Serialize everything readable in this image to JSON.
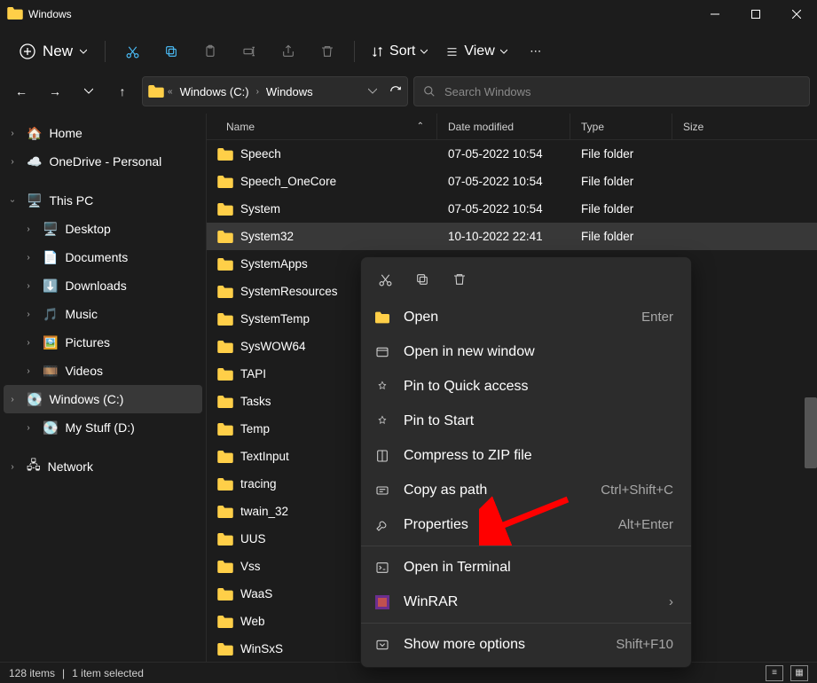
{
  "window": {
    "title": "Windows"
  },
  "toolbar": {
    "new": "New",
    "sort": "Sort",
    "view": "View"
  },
  "breadcrumb": {
    "drive": "Windows (C:)",
    "folder": "Windows"
  },
  "search": {
    "placeholder": "Search Windows"
  },
  "sidebar": {
    "home": "Home",
    "onedrive": "OneDrive - Personal",
    "thispc": "This PC",
    "desktop": "Desktop",
    "documents": "Documents",
    "downloads": "Downloads",
    "music": "Music",
    "pictures": "Pictures",
    "videos": "Videos",
    "cdrive": "Windows (C:)",
    "ddrive": "My Stuff (D:)",
    "network": "Network"
  },
  "columns": {
    "name": "Name",
    "modified": "Date modified",
    "type": "Type",
    "size": "Size"
  },
  "rows": [
    {
      "name": "Speech",
      "date": "07-05-2022 10:54",
      "type": "File folder"
    },
    {
      "name": "Speech_OneCore",
      "date": "07-05-2022 10:54",
      "type": "File folder"
    },
    {
      "name": "System",
      "date": "07-05-2022 10:54",
      "type": "File folder"
    },
    {
      "name": "System32",
      "date": "10-10-2022 22:41",
      "type": "File folder",
      "selected": true
    },
    {
      "name": "SystemApps",
      "date": "",
      "type": ""
    },
    {
      "name": "SystemResources",
      "date": "",
      "type": ""
    },
    {
      "name": "SystemTemp",
      "date": "",
      "type": ""
    },
    {
      "name": "SysWOW64",
      "date": "",
      "type": ""
    },
    {
      "name": "TAPI",
      "date": "",
      "type": ""
    },
    {
      "name": "Tasks",
      "date": "",
      "type": ""
    },
    {
      "name": "Temp",
      "date": "",
      "type": ""
    },
    {
      "name": "TextInput",
      "date": "",
      "type": ""
    },
    {
      "name": "tracing",
      "date": "",
      "type": ""
    },
    {
      "name": "twain_32",
      "date": "",
      "type": ""
    },
    {
      "name": "UUS",
      "date": "",
      "type": ""
    },
    {
      "name": "Vss",
      "date": "",
      "type": ""
    },
    {
      "name": "WaaS",
      "date": "",
      "type": ""
    },
    {
      "name": "Web",
      "date": "",
      "type": ""
    },
    {
      "name": "WinSxS",
      "date": "",
      "type": ""
    }
  ],
  "context_menu": [
    {
      "icon": "folder",
      "label": "Open",
      "accel": "Enter"
    },
    {
      "icon": "window",
      "label": "Open in new window",
      "accel": ""
    },
    {
      "icon": "pin",
      "label": "Pin to Quick access",
      "accel": ""
    },
    {
      "icon": "pin",
      "label": "Pin to Start",
      "accel": ""
    },
    {
      "icon": "zip",
      "label": "Compress to ZIP file",
      "accel": ""
    },
    {
      "icon": "path",
      "label": "Copy as path",
      "accel": "Ctrl+Shift+C"
    },
    {
      "icon": "wrench",
      "label": "Properties",
      "accel": "Alt+Enter"
    },
    {
      "sep": true
    },
    {
      "icon": "terminal",
      "label": "Open in Terminal",
      "accel": ""
    },
    {
      "icon": "winrar",
      "label": "WinRAR",
      "accel": "",
      "submenu": true
    },
    {
      "sep": true
    },
    {
      "icon": "more",
      "label": "Show more options",
      "accel": "Shift+F10"
    }
  ],
  "status": {
    "count": "128 items",
    "selection": "1 item selected"
  }
}
